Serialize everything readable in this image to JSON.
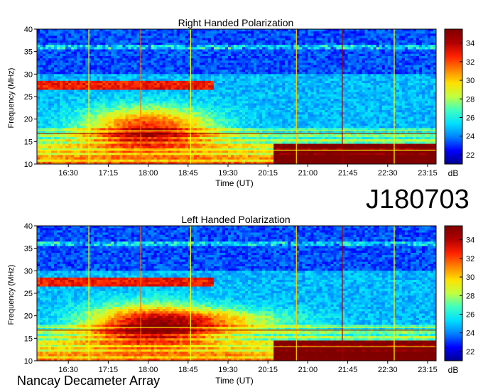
{
  "figure_id": "J180703",
  "footer_label": "Nancay Decameter Array",
  "colorbar_unit": "dB",
  "colormap": [
    "#00008f",
    "#0000ff",
    "#0080ff",
    "#00e0ff",
    "#40ffbf",
    "#c0ff40",
    "#ffe000",
    "#ff8000",
    "#ff2000",
    "#b00000",
    "#800000"
  ],
  "chart_data": [
    {
      "type": "heatmap",
      "title": "Right Handed Polarization",
      "xlabel": "Time (UT)",
      "ylabel": "Frequency (MHz)",
      "x_ticks": [
        "16:30",
        "17:15",
        "18:00",
        "18:45",
        "19:30",
        "20:15",
        "21:00",
        "21:45",
        "22:30",
        "23:15"
      ],
      "y_ticks": [
        10,
        15,
        20,
        25,
        30,
        35,
        40
      ],
      "ylim": [
        10,
        40
      ],
      "colorbar_ticks": [
        22,
        24,
        26,
        28,
        30,
        32,
        34
      ],
      "colorbar_range": [
        21,
        35.5
      ]
    },
    {
      "type": "heatmap",
      "title": "Left Handed Polarization",
      "xlabel": "Time (UT)",
      "ylabel": "Frequency (MHz)",
      "x_ticks": [
        "16:30",
        "17:15",
        "18:00",
        "18:45",
        "19:30",
        "20:15",
        "21:00",
        "21:45",
        "22:30",
        "23:15"
      ],
      "y_ticks": [
        10,
        15,
        20,
        25,
        30,
        35,
        40
      ],
      "ylim": [
        10,
        40
      ],
      "colorbar_ticks": [
        22,
        24,
        26,
        28,
        30,
        32,
        34
      ],
      "colorbar_range": [
        21,
        35.5
      ]
    }
  ]
}
